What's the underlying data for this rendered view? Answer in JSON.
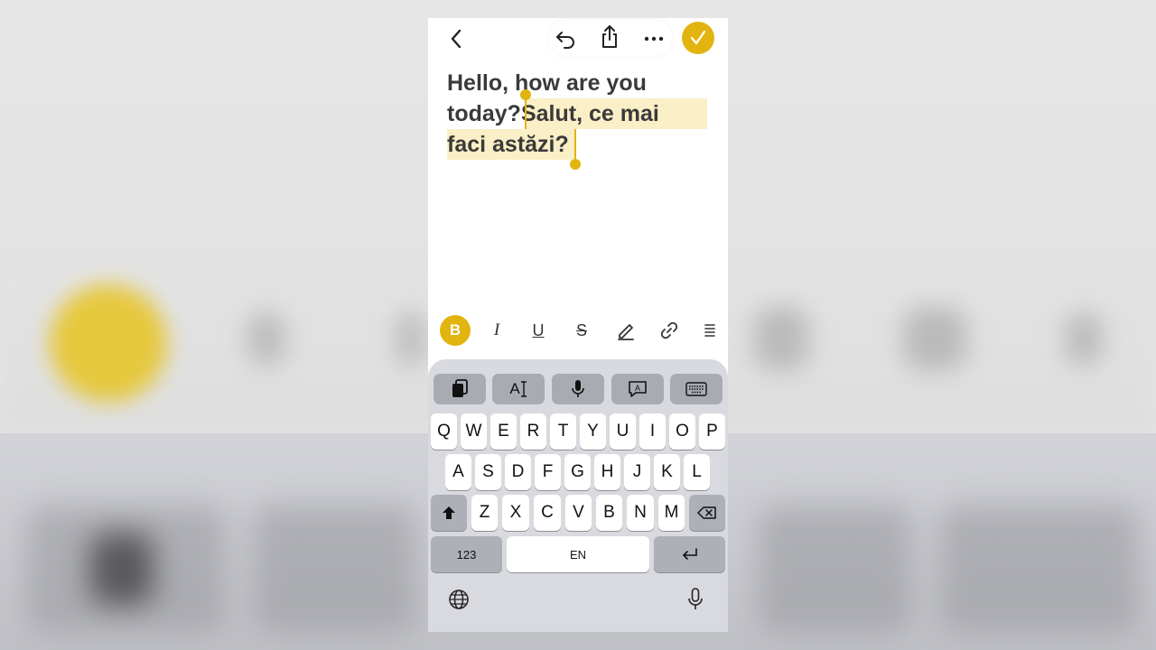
{
  "editor": {
    "line1": "Hello, how are you",
    "line2_plain": "today?",
    "line2_selected": "Salut, ce mai",
    "line3_selected": "faci astăzi?"
  },
  "toolbar": {
    "back_icon": "chevron-left-icon",
    "undo_icon": "undo-icon",
    "share_icon": "share-icon",
    "more_icon": "more-icon",
    "done_icon": "checkmark-icon",
    "accent_color": "#e2b410"
  },
  "format_bar": {
    "bold_label": "B",
    "italic_label": "I",
    "underline_label": "U",
    "strike_label": "S"
  },
  "keyboard": {
    "tool_text_label": "A",
    "row1": [
      "Q",
      "W",
      "E",
      "R",
      "T",
      "Y",
      "U",
      "I",
      "O",
      "P"
    ],
    "row2": [
      "A",
      "S",
      "D",
      "F",
      "G",
      "H",
      "J",
      "K",
      "L"
    ],
    "row3": [
      "Z",
      "X",
      "C",
      "V",
      "B",
      "N",
      "M"
    ],
    "numbers_label": "123",
    "space_label": "EN"
  }
}
